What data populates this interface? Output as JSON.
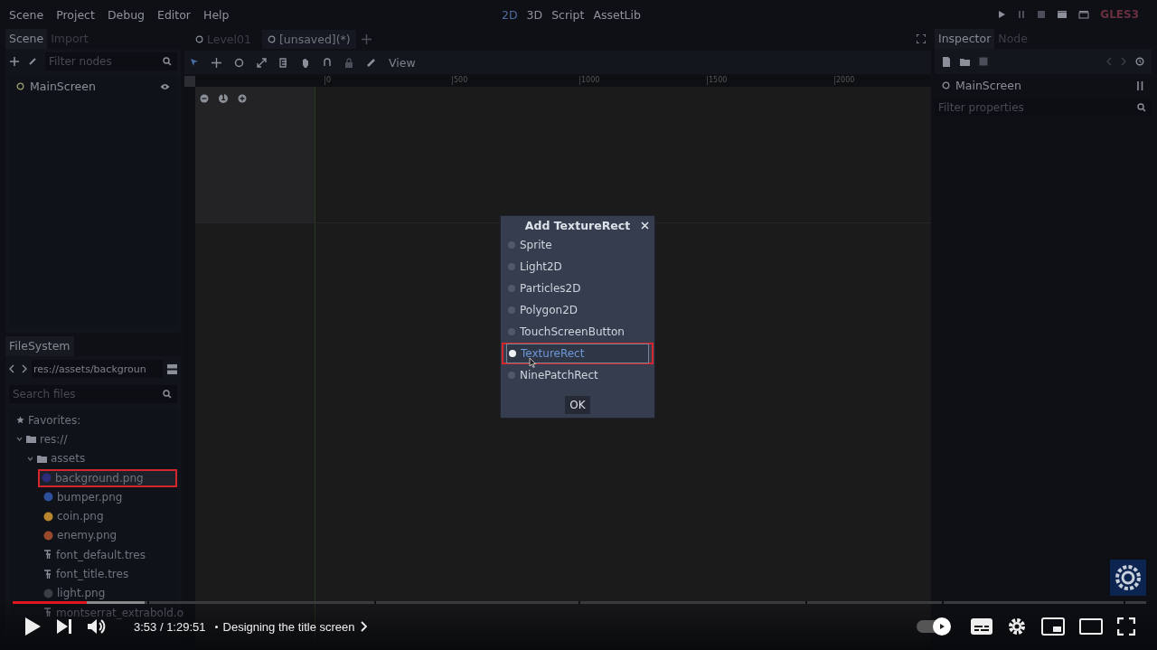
{
  "menu": [
    "Scene",
    "Project",
    "Debug",
    "Editor",
    "Help"
  ],
  "workspaces": [
    {
      "label": "2D",
      "selected": true
    },
    {
      "label": "3D",
      "selected": false
    },
    {
      "label": "Script",
      "selected": false
    },
    {
      "label": "AssetLib",
      "selected": false
    }
  ],
  "renderer": "GLES3",
  "scene_dock": {
    "tabs": [
      {
        "label": "Scene",
        "selected": true
      },
      {
        "label": "Import",
        "selected": false
      }
    ],
    "filter": {
      "placeholder": "Filter nodes"
    },
    "tree": [
      {
        "label": "MainScreen"
      }
    ]
  },
  "filesystem": {
    "title": "FileSystem",
    "path": "res://assets/backgroun",
    "search": {
      "placeholder": "Search files"
    },
    "tree": [
      {
        "label": "Favorites:",
        "kind": "favorites"
      },
      {
        "label": "res://",
        "kind": "folder",
        "expanded": true,
        "children": [
          {
            "label": "assets",
            "kind": "folder",
            "expanded": true,
            "children": [
              {
                "label": "background.png",
                "kind": "image",
                "color": "#2c2c78",
                "highlighted": true
              },
              {
                "label": "bumper.png",
                "kind": "image",
                "color": "#2e4f9c",
                "highlighted": false
              },
              {
                "label": "coin.png",
                "kind": "image",
                "color": "#b8862e",
                "highlighted": false
              },
              {
                "label": "enemy.png",
                "kind": "image",
                "color": "#9a4a2c",
                "highlighted": false
              },
              {
                "label": "font_default.tres",
                "kind": "font",
                "highlighted": false
              },
              {
                "label": "font_title.tres",
                "kind": "font",
                "highlighted": false
              },
              {
                "label": "light.png",
                "kind": "image",
                "color": "#3a3d44",
                "highlighted": false
              },
              {
                "label": "montserrat_extrabold.o",
                "kind": "font",
                "highlighted": false
              }
            ]
          }
        ]
      }
    ]
  },
  "scene_tabs": [
    {
      "label": "Level01",
      "selected": false
    },
    {
      "label": "[unsaved](*)",
      "selected": true
    }
  ],
  "toolbar": {
    "view_menu": "View"
  },
  "ruler": {
    "ticks": [
      "0",
      "500",
      "1000",
      "1500",
      "2000"
    ]
  },
  "zoom": {
    "reset": "1"
  },
  "inspector": {
    "tabs": [
      {
        "label": "Inspector",
        "selected": true
      },
      {
        "label": "Node",
        "selected": false
      }
    ],
    "node": "MainScreen",
    "filter": {
      "placeholder": "Filter properties"
    }
  },
  "dialog": {
    "title": "Add TextureRect",
    "options": [
      {
        "label": "Sprite",
        "selected": false,
        "highlighted": false
      },
      {
        "label": "Light2D",
        "selected": false,
        "highlighted": false
      },
      {
        "label": "Particles2D",
        "selected": false,
        "highlighted": false
      },
      {
        "label": "Polygon2D",
        "selected": false,
        "highlighted": false
      },
      {
        "label": "TouchScreenButton",
        "selected": false,
        "highlighted": false
      },
      {
        "label": "TextureRect",
        "selected": true,
        "highlighted": true
      },
      {
        "label": "NinePatchRect",
        "selected": false,
        "highlighted": false
      }
    ],
    "button": "OK"
  },
  "player": {
    "time": "3:53 / 1:29:51",
    "chapter": "Designing the title screen",
    "progress": {
      "level": 0.067
    },
    "buffered": {
      "level": 0.118
    },
    "autoplay": {
      "on": true
    }
  }
}
